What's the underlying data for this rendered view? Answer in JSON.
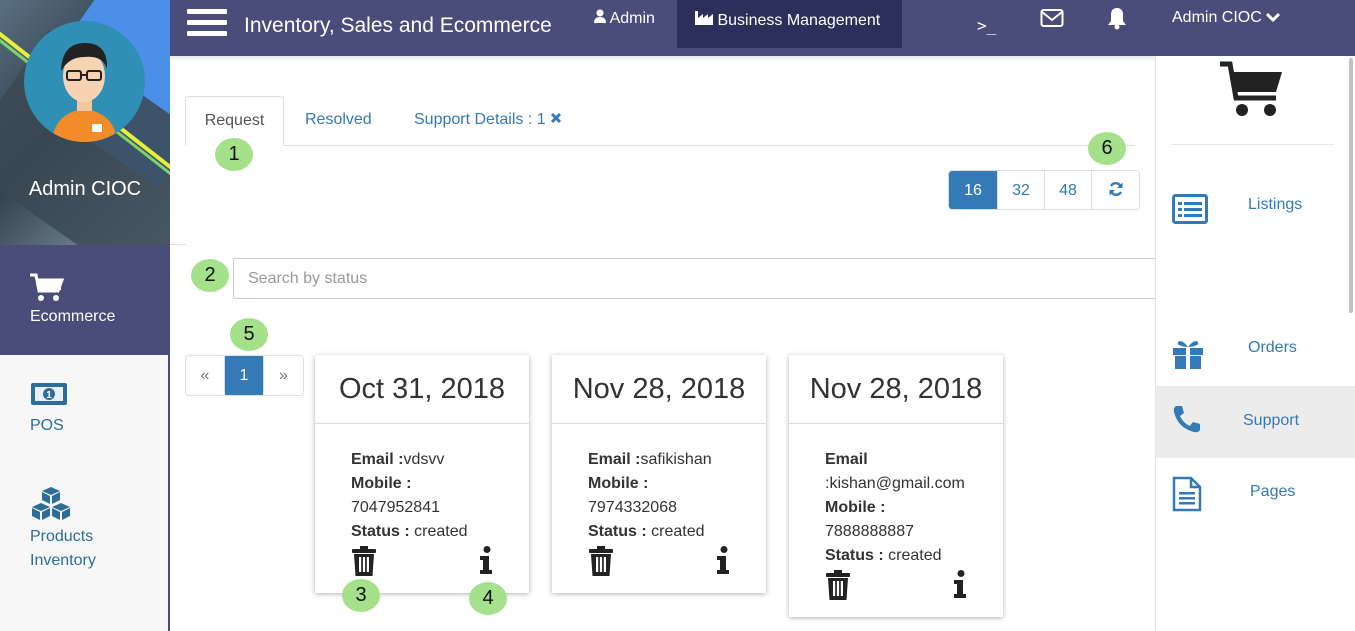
{
  "header": {
    "app_title": "Inventory, Sales and Ecommerce",
    "nav_admin": "Admin",
    "nav_business": "Business Management",
    "terminal_glyph": ">_",
    "user_menu": "Admin CIOC"
  },
  "profile": {
    "name": "Admin CIOC"
  },
  "sidebar": {
    "items": [
      {
        "label": "Ecommerce",
        "icon": "cart-icon",
        "active": true
      },
      {
        "label": "POS",
        "icon": "money-icon"
      },
      {
        "label": "Products Inventory",
        "icon": "cubes-icon"
      }
    ]
  },
  "tabs": [
    {
      "label": "Request",
      "active": true
    },
    {
      "label": "Resolved"
    },
    {
      "label": "Support Details : 1",
      "closable": true
    }
  ],
  "page_size": {
    "options": [
      "16",
      "32",
      "48"
    ],
    "selected": "16",
    "refresh_icon": "refresh-icon"
  },
  "search": {
    "placeholder": "Search by status",
    "value": ""
  },
  "pagination": {
    "prev": "«",
    "current": "1",
    "next": "»"
  },
  "cards": [
    {
      "date": "Oct 31, 2018",
      "email_label": "Email :",
      "email": "vdsvv",
      "mobile_label": "Mobile :",
      "mobile": "7047952841",
      "status_label": "Status :",
      "status": "created"
    },
    {
      "date": "Nov 28, 2018",
      "email_label": "Email :",
      "email": "safikishan",
      "mobile_label": "Mobile :",
      "mobile": "7974332068",
      "status_label": "Status :",
      "status": "created"
    },
    {
      "date": "Nov 28, 2018",
      "email_label": "Email",
      "email": ":kishan@gmail.com",
      "mobile_label": "Mobile :",
      "mobile": "7888888887",
      "status_label": "Status :",
      "status": "created"
    }
  ],
  "markers": [
    "1",
    "2",
    "3",
    "4",
    "5",
    "6"
  ],
  "right_panel": {
    "items": [
      {
        "label": "Listings",
        "icon": "list-icon"
      },
      {
        "label": "Orders",
        "icon": "gift-icon"
      },
      {
        "label": "Support",
        "icon": "phone-icon",
        "active": true
      },
      {
        "label": "Pages",
        "icon": "document-icon"
      }
    ]
  },
  "colors": {
    "nav": "#4a4d7a",
    "nav_active": "#2c2f5a",
    "primary": "#337ab7",
    "marker": "#a4e18a"
  }
}
